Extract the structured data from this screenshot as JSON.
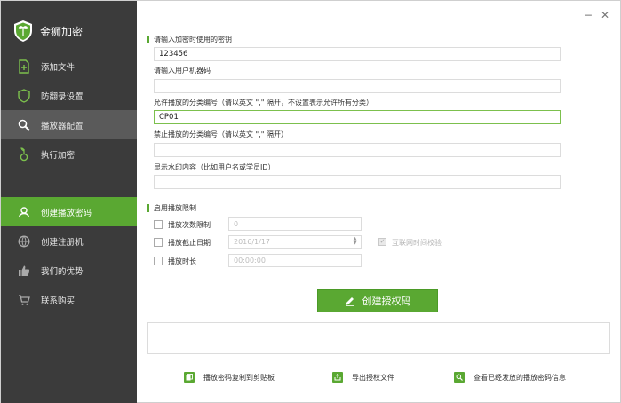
{
  "app": {
    "title": "金狮加密"
  },
  "window_controls": {
    "minimize": "−",
    "close": "✕"
  },
  "sidebar": {
    "items": [
      {
        "label": "添加文件",
        "icon": "add-file-icon"
      },
      {
        "label": "防翻录设置",
        "icon": "shield-icon"
      },
      {
        "label": "播放器配置",
        "icon": "search-icon"
      },
      {
        "label": "执行加密",
        "icon": "seedling-icon"
      },
      {
        "label": "创建播放密码",
        "icon": "user-icon"
      },
      {
        "label": "创建注册机",
        "icon": "globe-icon"
      },
      {
        "label": "我们的优势",
        "icon": "thumbs-up-icon"
      },
      {
        "label": "联系购买",
        "icon": "cart-icon"
      }
    ],
    "active_index": 4,
    "highlight_index": 2
  },
  "form": {
    "key_section_title": "请输入加密时使用的密钥",
    "key_value": "123456",
    "machine_code_label": "请输入用户机器码",
    "machine_code_value": "",
    "allowed_category_label": "允许播放的分类编号（请以英文 \",\" 隔开，不设置表示允许所有分类）",
    "allowed_category_value": "CP01",
    "forbidden_category_label": "禁止播放的分类编号（请以英文 \",\" 隔开）",
    "forbidden_category_value": "",
    "watermark_label": "显示水印内容（比如用户名或学员ID）",
    "watermark_value": ""
  },
  "limits": {
    "section_title": "启用播放限制",
    "play_count_label": "播放次数限制",
    "play_count_value": "0",
    "play_until_label": "播放截止日期",
    "play_until_value": "2016/1/17",
    "play_duration_label": "播放时长",
    "play_duration_value": "00:00:00",
    "network_time_label": "互联网时间校验"
  },
  "create_button": {
    "label": "创建授权码"
  },
  "actions": {
    "copy_label": "播放密码复制到剪贴板",
    "export_label": "导出授权文件",
    "view_label": "查看已经发放的播放密码信息"
  },
  "colors": {
    "accent": "#5aa832",
    "sidebar_bg": "#3b3b3b",
    "sidebar_selected": "#5a5a5a"
  }
}
